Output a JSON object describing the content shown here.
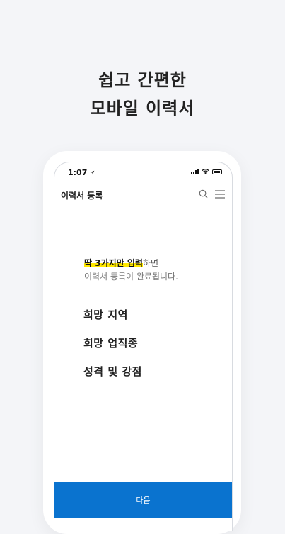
{
  "headline": {
    "line1": "쉽고 간편한",
    "line2": "모바일 이력서"
  },
  "status_bar": {
    "time": "1:07",
    "icons": [
      "location-arrow-icon",
      "signal-icon",
      "wifi-icon",
      "battery-icon"
    ]
  },
  "app_bar": {
    "title": "이력서 등록",
    "icons": [
      "search-icon",
      "menu-icon"
    ]
  },
  "intro": {
    "highlight": "딱 3가지만 입력",
    "suffix": "하면",
    "line2": "이력서 등록이 완료됩니다."
  },
  "items": [
    {
      "label": "희망 지역"
    },
    {
      "label": "희망 업직종"
    },
    {
      "label": "성격 및 강점"
    }
  ],
  "next_button": {
    "label": "다음"
  },
  "colors": {
    "background": "#f4f5f8",
    "accent": "#0a73cf",
    "highlight": "#ffe800"
  }
}
